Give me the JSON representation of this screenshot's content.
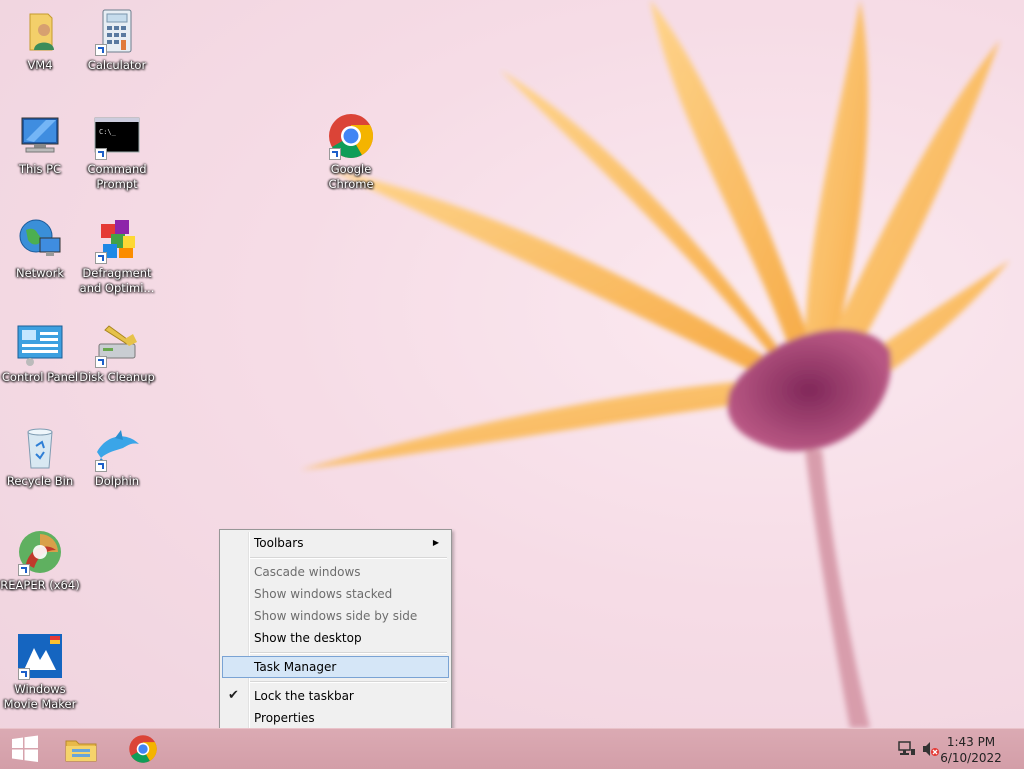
{
  "desktop": {
    "icons": [
      {
        "label": "VM4"
      },
      {
        "label": "Calculator"
      },
      {
        "label": "This PC"
      },
      {
        "label": "Command Prompt"
      },
      {
        "label": "Google Chrome"
      },
      {
        "label": "Network"
      },
      {
        "label": "Defragment and Optimi..."
      },
      {
        "label": "Control Panel"
      },
      {
        "label": "Disk Cleanup"
      },
      {
        "label": "Recycle Bin"
      },
      {
        "label": "Dolphin"
      },
      {
        "label": "REAPER (x64)"
      },
      {
        "label": "Windows Movie Maker"
      }
    ]
  },
  "context_menu": {
    "items": [
      {
        "label": "Toolbars",
        "state": "enabled",
        "submenu": true
      },
      {
        "label": "Cascade windows",
        "state": "disabled"
      },
      {
        "label": "Show windows stacked",
        "state": "disabled"
      },
      {
        "label": "Show windows side by side",
        "state": "disabled"
      },
      {
        "label": "Show the desktop",
        "state": "enabled"
      },
      {
        "label": "Task Manager",
        "state": "highlighted"
      },
      {
        "label": "Lock the taskbar",
        "state": "checked"
      },
      {
        "label": "Properties",
        "state": "enabled"
      }
    ]
  },
  "taskbar": {
    "clock_time": "1:43 PM",
    "clock_date": "6/10/2022",
    "color": "#d5a2ac"
  }
}
